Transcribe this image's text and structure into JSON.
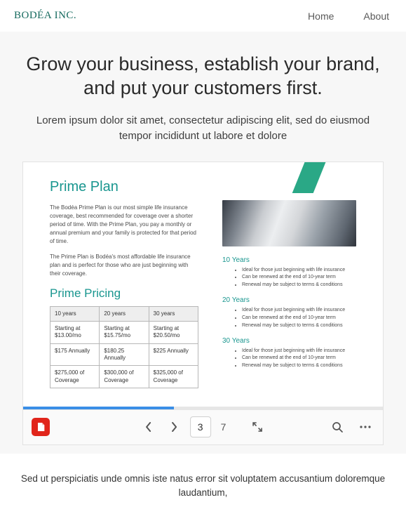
{
  "brand": "BODÉA INC.",
  "nav": {
    "home": "Home",
    "about": "About"
  },
  "hero": {
    "headline": "Grow your business, establish your brand, and put your customers first.",
    "subhead": "Lorem ipsum dolor sit amet, consectetur adipiscing elit, sed do eiusmod tempor incididunt ut labore et dolore"
  },
  "doc": {
    "title": "Prime Plan",
    "intro1": "The Bodéa Prime Plan is our most simple life insurance coverage, best recommended for coverage over a shorter period of time. With the Prime Plan, you pay a monthly or annual premium and your family is protected for that period of time.",
    "intro2": "The Prime Plan is Bodéa's most affordable life insurance plan and is perfect for those who are just beginning with their coverage.",
    "pricing_title": "Prime Pricing",
    "table": {
      "headers": [
        "10 years",
        "20 years",
        "30 years"
      ],
      "rows": [
        [
          "Starting at $13.00/mo",
          "Starting at $15.75/mo",
          "Starting at $20.50/mo"
        ],
        [
          "$175 Annually",
          "$180.25 Annually",
          "$225 Annually"
        ],
        [
          "$275,000 of Coverage",
          "$300,000 of Coverage",
          "$325,000 of Coverage"
        ]
      ]
    },
    "years": [
      {
        "label": "10 Years",
        "bullets": [
          "Ideal for those just beginning with life insurance",
          "Can be renewed at the end of 10-year term",
          "Renewal may be subject to terms & conditions"
        ]
      },
      {
        "label": "20 Years",
        "bullets": [
          "Ideal for those just beginning with life insurance",
          "Can be renewed at the end of 10-year term",
          "Renewal may be subject to terms & conditions"
        ]
      },
      {
        "label": "30 Years",
        "bullets": [
          "Ideal for those just beginning with life insurance",
          "Can be renewed at the end of 10-year term",
          "Renewal may be subject to terms & conditions"
        ]
      }
    ]
  },
  "viewer": {
    "current_page": "3",
    "total_pages": "7"
  },
  "footer": "Sed ut perspiciatis unde omnis iste natus error sit voluptatem accusantium doloremque laudantium,"
}
